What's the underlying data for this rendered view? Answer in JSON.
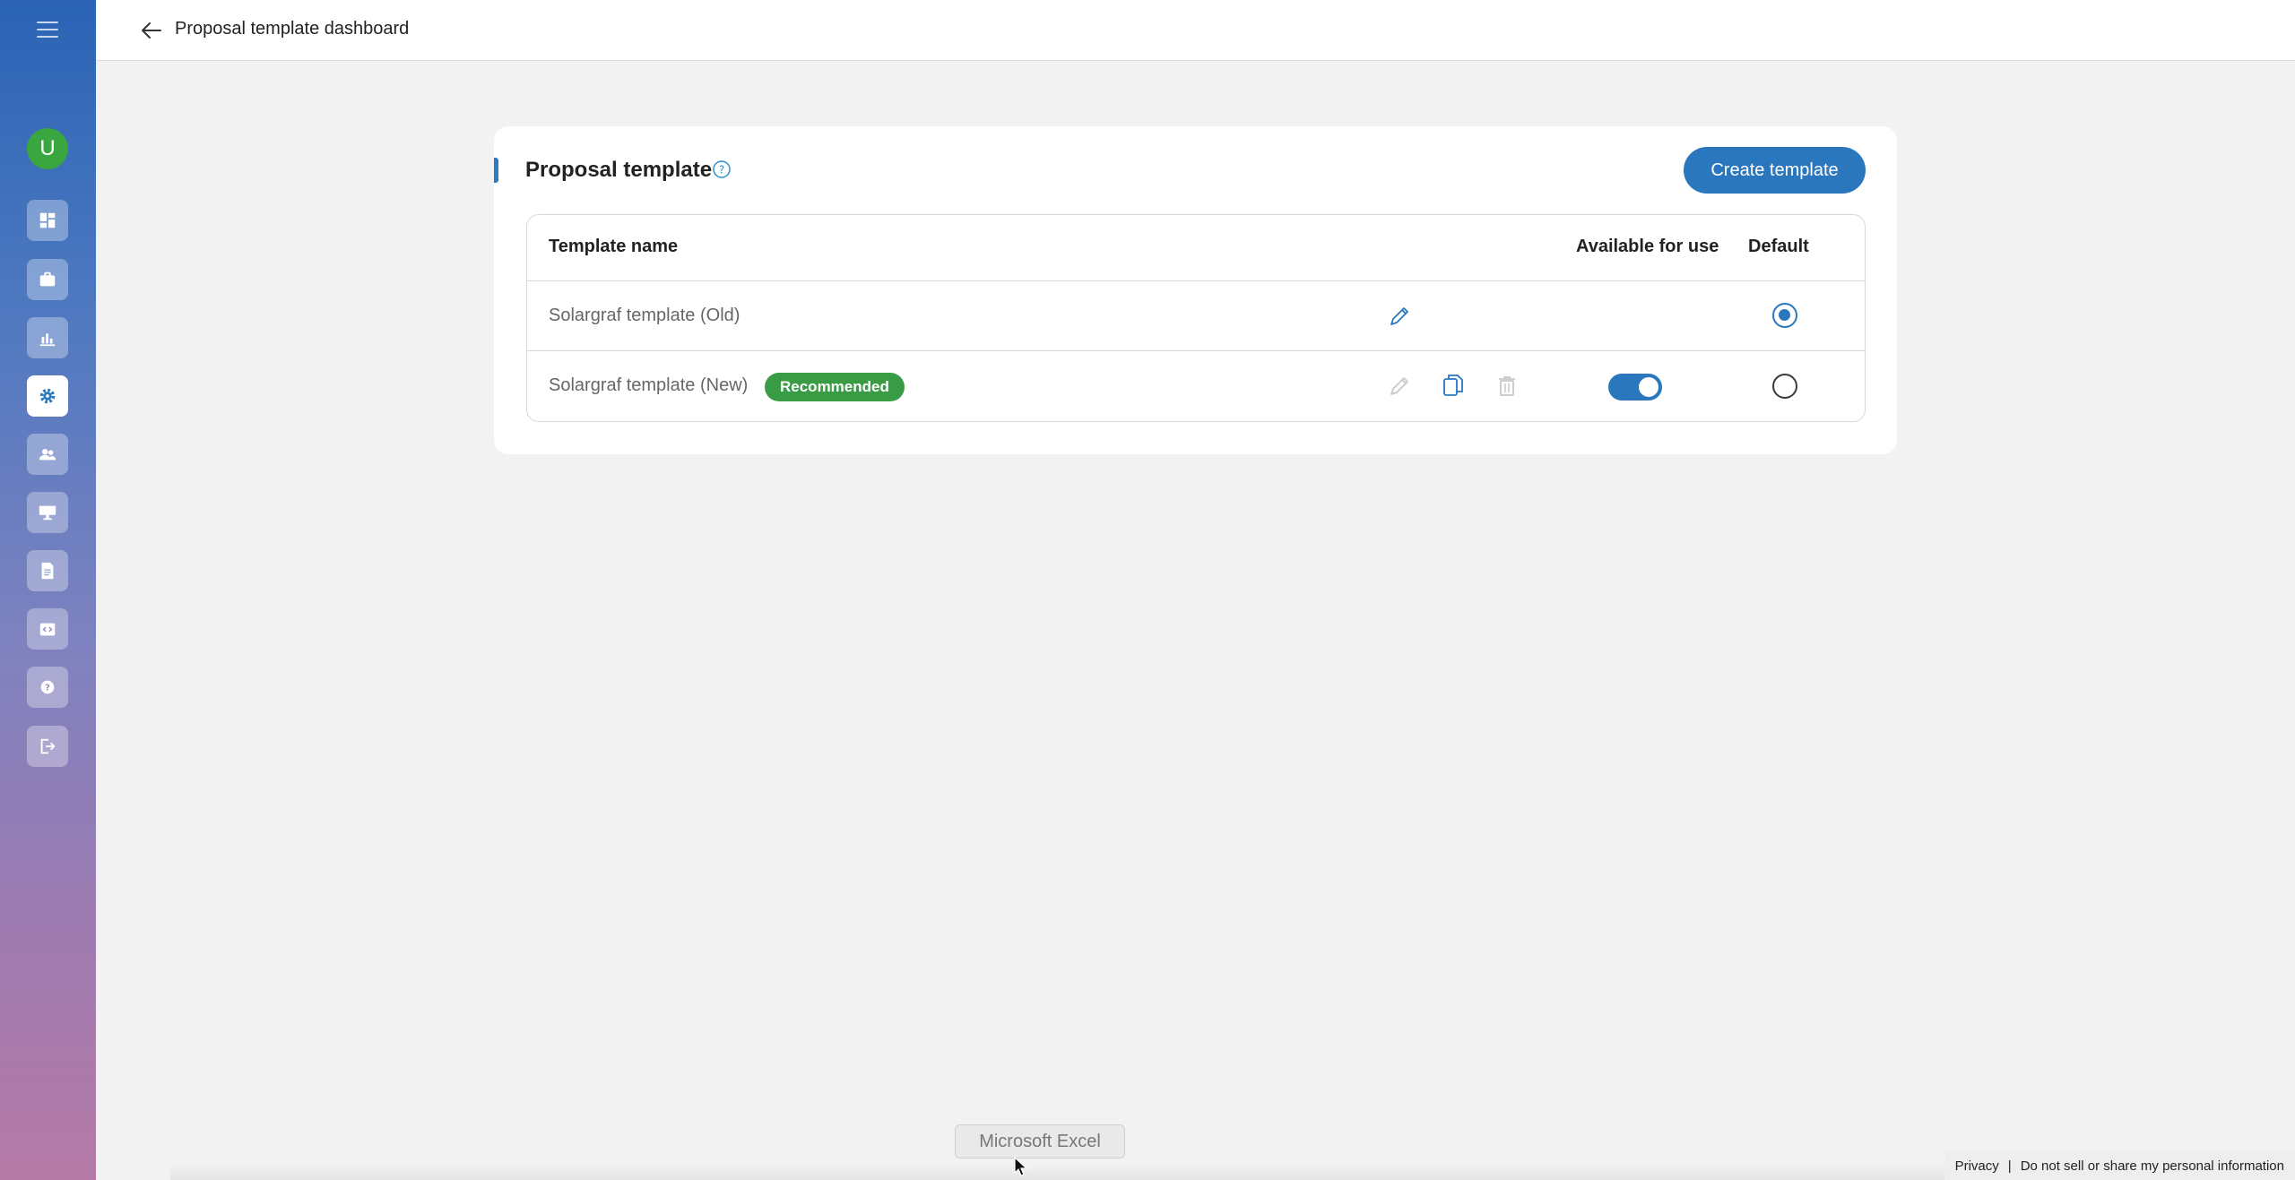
{
  "header": {
    "title": "Proposal template dashboard"
  },
  "sidebar": {
    "avatar_initial": "U",
    "items": [
      {
        "name": "dashboard-icon",
        "active": false
      },
      {
        "name": "briefcase-icon",
        "active": false
      },
      {
        "name": "chart-icon",
        "active": false
      },
      {
        "name": "gear-icon",
        "active": true
      },
      {
        "name": "people-icon",
        "active": false
      },
      {
        "name": "monitor-icon",
        "active": false
      },
      {
        "name": "document-icon",
        "active": false
      },
      {
        "name": "code-icon",
        "active": false
      },
      {
        "name": "help-icon",
        "active": false
      },
      {
        "name": "logout-icon",
        "active": false
      }
    ]
  },
  "card": {
    "title": "Proposal template",
    "create_button": "Create template",
    "columns": {
      "name": "Template name",
      "available": "Available for use",
      "default": "Default"
    },
    "rows": [
      {
        "name": "Solargraf template (Old)",
        "badge": "",
        "available": null,
        "default": true
      },
      {
        "name": "Solargraf template (New)",
        "badge": "Recommended",
        "available": true,
        "default": false
      }
    ]
  },
  "overlay": {
    "taskbar_tooltip": "Microsoft Excel"
  },
  "footer": {
    "privacy": "Privacy",
    "separator": "|",
    "do_not_sell": "Do not sell or share my personal information"
  },
  "colors": {
    "accent": "#2a77bd",
    "badge_green": "#3a9b45",
    "avatar_green": "#3aa63f"
  }
}
